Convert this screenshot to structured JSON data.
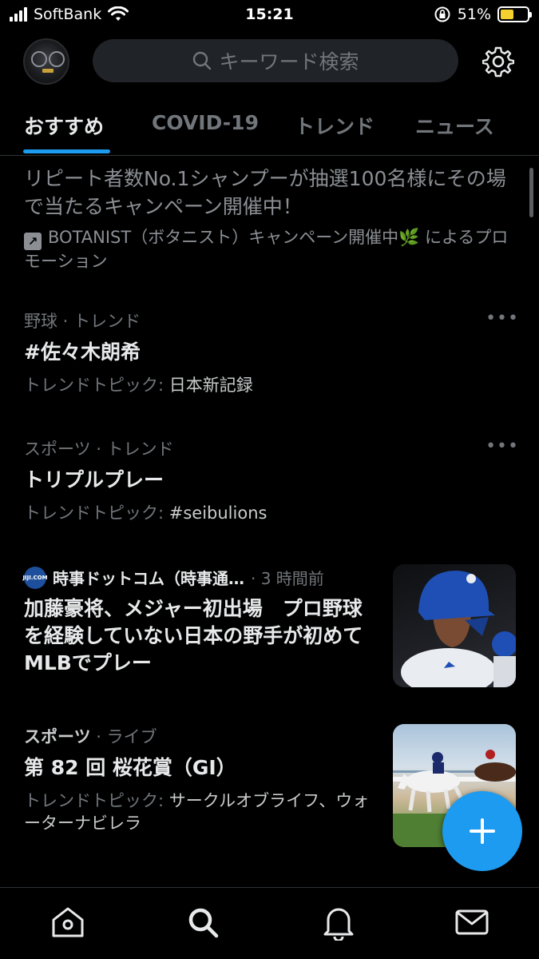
{
  "status_bar": {
    "carrier": "SoftBank",
    "time": "15:21",
    "battery_percent": "51%",
    "battery_level": 0.51
  },
  "header": {
    "search_placeholder": "キーワード検索"
  },
  "tabs": [
    {
      "label": "おすすめ",
      "active": true
    },
    {
      "label": "COVID-19",
      "active": false
    },
    {
      "label": "トレンド",
      "active": false
    },
    {
      "label": "ニュース",
      "active": false
    }
  ],
  "promo": {
    "text": "リピート者数No.1シャンプーが抽選100名様にその場で当たるキャンペーン開催中！",
    "by": "BOTANIST（ボタニスト）キャンペーン開催中🌿 によるプロモーション"
  },
  "trends": [
    {
      "category": "野球 · トレンド",
      "title": "#佐々木朗希",
      "topic_label": "トレンドトピック: ",
      "topic_value": "日本新記録"
    },
    {
      "category": "スポーツ · トレンド",
      "title": "トリプルプレー",
      "topic_label": "トレンドトピック: ",
      "topic_value": "#seibulions"
    }
  ],
  "news": {
    "source_logo": "JIJI.COM",
    "source": "時事ドットコム（時事通…",
    "time": "· 3 時間前",
    "title": "加藤豪将、メジャー初出場　プロ野球を経験していない日本の野手が初めてMLBでプレー"
  },
  "live": {
    "category_main": "スポーツ",
    "category_rest": " · ライブ",
    "title": "第 82 回 桜花賞（GI）",
    "topic_label": "トレンドトピック: ",
    "topic_value": "サークルオブライフ、ウォーターナビレラ"
  },
  "icons": {
    "home": "home-icon",
    "search": "search-icon",
    "notifications": "bell-icon",
    "messages": "mail-icon",
    "settings": "gear-icon",
    "compose": "plus-icon"
  },
  "colors": {
    "accent": "#1d9bf0",
    "background": "#000000",
    "battery": "#f5d130"
  }
}
